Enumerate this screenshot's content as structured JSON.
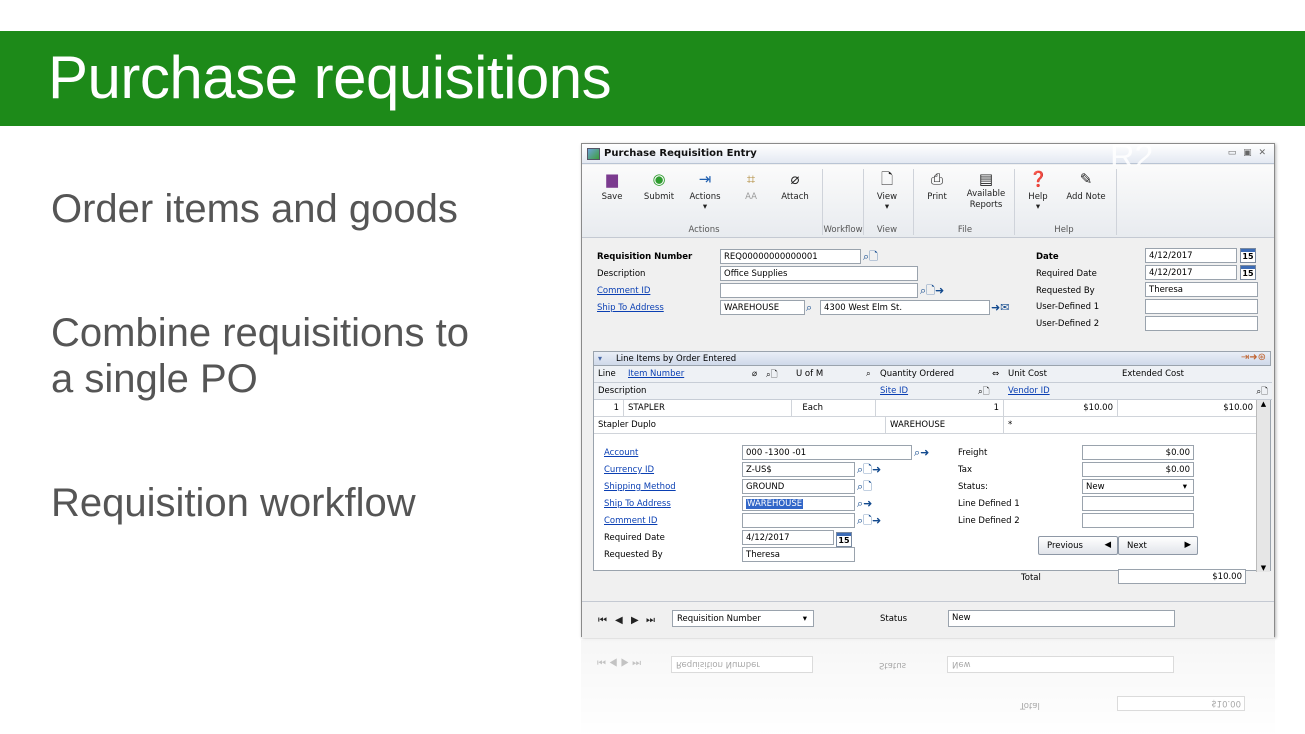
{
  "slide": {
    "title": "Purchase requisitions",
    "bullets": [
      "Order items and goods",
      "Combine requisitions to",
      "a single PO",
      "Requisition workflow"
    ],
    "ghost_text": "R2"
  },
  "window": {
    "title": "Purchase Requisition Entry",
    "controls": "▭ ▣ ✕",
    "ribbon": {
      "buttons": {
        "save": "Save",
        "submit": "Submit",
        "actions": "Actions",
        "aa": "AA",
        "attach": "Attach",
        "view": "View",
        "print": "Print",
        "available_reports": "Available\nReports",
        "help": "Help",
        "add_note": "Add Note"
      },
      "groups": {
        "actions": "Actions",
        "workflow": "Workflow",
        "view": "View",
        "file": "File",
        "help": "Help"
      }
    },
    "header": {
      "requisition_number_label": "Requisition Number",
      "requisition_number": "REQ00000000000001",
      "description_label": "Description",
      "description": "Office Supplies",
      "comment_id_label": "Comment ID",
      "comment_id": "",
      "ship_to_label": "Ship To Address",
      "ship_to_code": "WAREHOUSE",
      "ship_to_address": "4300 West Elm St.",
      "date_label": "Date",
      "date": "4/12/2017",
      "required_date_label": "Required Date",
      "required_date": "4/12/2017",
      "requested_by_label": "Requested By",
      "requested_by": "Theresa",
      "user_defined_1_label": "User-Defined 1",
      "user_defined_2_label": "User-Defined 2",
      "cal_day": "15"
    },
    "grid": {
      "title": "Line Items by Order Entered",
      "columns": {
        "line": "Line",
        "item_number": "Item Number",
        "uofm": "U of M",
        "qty": "Quantity Ordered",
        "unit_cost": "Unit Cost",
        "extended_cost": "Extended Cost",
        "description": "Description",
        "site_id": "Site ID",
        "vendor_id": "Vendor ID"
      },
      "row": {
        "line": "1",
        "item": "STAPLER",
        "uofm": "Each",
        "qty": "1",
        "unit_cost": "$10.00",
        "extended_cost": "$10.00",
        "description": "Stapler Duplo",
        "site": "WAREHOUSE",
        "vendor": "*"
      },
      "detail": {
        "account_label": "Account",
        "account": "000 -1300 -01",
        "currency_label": "Currency ID",
        "currency": "Z-US$",
        "shipping_method_label": "Shipping Method",
        "shipping_method": "GROUND",
        "ship_to_label": "Ship To Address",
        "ship_to": "WAREHOUSE",
        "comment_label": "Comment ID",
        "comment": "",
        "required_date_label": "Required Date",
        "required_date": "4/12/2017",
        "requested_by_label": "Requested By",
        "requested_by": "Theresa",
        "freight_label": "Freight",
        "freight": "$0.00",
        "tax_label": "Tax",
        "tax": "$0.00",
        "status_label": "Status:",
        "status": "New",
        "line_defined_1_label": "Line Defined 1",
        "line_defined_2_label": "Line Defined 2",
        "previous": "Previous",
        "next": "Next"
      },
      "total_label": "Total",
      "total": "$10.00"
    },
    "footer": {
      "sort_by": "Requisition Number",
      "status_label": "Status",
      "status": "New"
    }
  }
}
